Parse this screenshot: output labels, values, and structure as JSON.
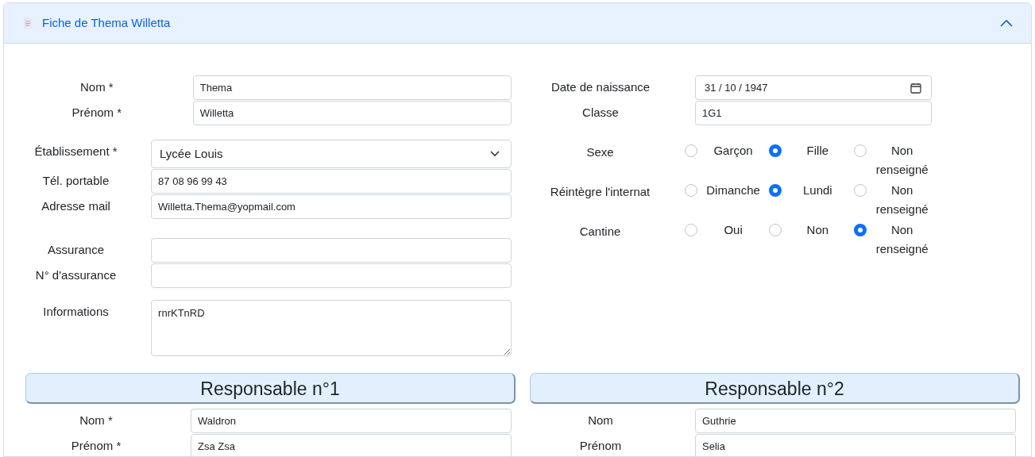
{
  "header": {
    "title": "Fiche de Thema Willetta",
    "expanded": true
  },
  "left_groups": [
    [
      {
        "label": "Nom *",
        "value": "Thema",
        "kind": "text"
      },
      {
        "label": "Prénom *",
        "value": "Willetta",
        "kind": "text"
      }
    ],
    [
      {
        "label": "Établissement *",
        "value": "Lycée Louis",
        "kind": "select"
      },
      {
        "label": "Tél. portable",
        "value": "87 08 96 99 43",
        "kind": "text"
      },
      {
        "label": "Adresse mail",
        "value": "Willetta.Thema@yopmail.com",
        "kind": "text"
      }
    ],
    [
      {
        "label": "Assurance",
        "kind": "text"
      },
      {
        "label": "N° d'assurance",
        "kind": "text"
      }
    ],
    [
      {
        "label": "Informations",
        "value": "rnrKTnRD",
        "kind": "textarea"
      }
    ]
  ],
  "right_fields": [
    {
      "label": "Date de naissance",
      "value": "31 / 10 / 1947",
      "kind": "date"
    },
    {
      "label": "Classe",
      "value": "1G1",
      "kind": "text"
    }
  ],
  "radio_groups": [
    {
      "label": "Sexe",
      "options": [
        {
          "label": "Garçon",
          "selected": false
        },
        {
          "label": "Fille",
          "selected": true
        },
        {
          "label": "Non renseigné",
          "selected": false
        }
      ]
    },
    {
      "label": "Réintègre l'internat",
      "options": [
        {
          "label": "Dimanche",
          "selected": false
        },
        {
          "label": "Lundi",
          "selected": true
        },
        {
          "label": "Non renseigné",
          "selected": false
        }
      ]
    },
    {
      "label": "Cantine",
      "options": [
        {
          "label": "Oui",
          "selected": false
        },
        {
          "label": "Non",
          "selected": false
        },
        {
          "label": "Non renseigné",
          "selected": true
        }
      ]
    }
  ],
  "responsables": [
    {
      "title": "Responsable n°1",
      "fields": [
        {
          "label": "Nom *",
          "value": "Waldron"
        },
        {
          "label": "Prénom *",
          "value": "Zsa Zsa"
        }
      ]
    },
    {
      "title": "Responsable n°2",
      "fields": [
        {
          "label": "Nom",
          "value": "Guthrie"
        },
        {
          "label": "Prénom",
          "value": "Selia"
        }
      ]
    }
  ]
}
